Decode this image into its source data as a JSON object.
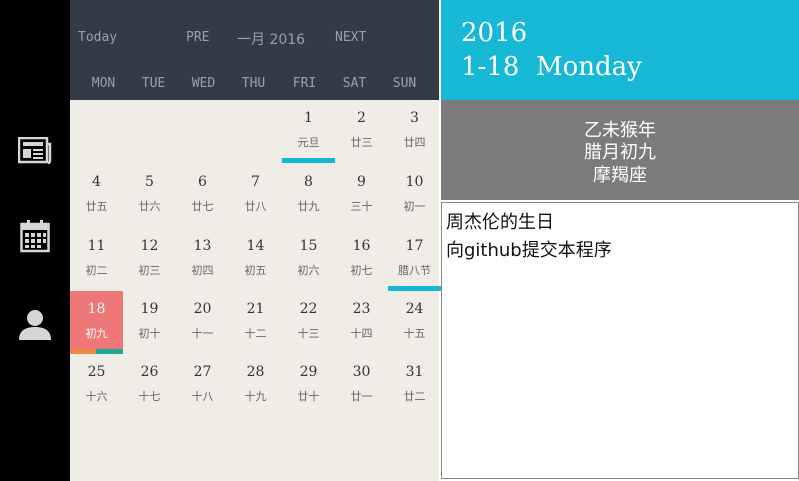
{
  "sidebar": {
    "items": [
      {
        "icon": "newspaper-icon"
      },
      {
        "icon": "calendar-icon"
      },
      {
        "icon": "user-icon"
      }
    ]
  },
  "header": {
    "today_label": "Today",
    "pre_label": "PRE",
    "month_title": "一月 2016",
    "next_label": "NEXT",
    "weekdays": [
      "MON",
      "TUE",
      "WED",
      "THU",
      "FRI",
      "SAT",
      "SUN"
    ]
  },
  "calendar": {
    "weeks": [
      [
        null,
        null,
        null,
        null,
        {
          "day": "1",
          "lunar": "元旦",
          "mark": "#17b8d6"
        },
        {
          "day": "2",
          "lunar": "廿三"
        },
        {
          "day": "3",
          "lunar": "廿四"
        }
      ],
      [
        {
          "day": "4",
          "lunar": "廿五"
        },
        {
          "day": "5",
          "lunar": "廿六"
        },
        {
          "day": "6",
          "lunar": "廿七"
        },
        {
          "day": "7",
          "lunar": "廿八"
        },
        {
          "day": "8",
          "lunar": "廿九"
        },
        {
          "day": "9",
          "lunar": "三十"
        },
        {
          "day": "10",
          "lunar": "初一"
        }
      ],
      [
        {
          "day": "11",
          "lunar": "初二"
        },
        {
          "day": "12",
          "lunar": "初三"
        },
        {
          "day": "13",
          "lunar": "初四"
        },
        {
          "day": "14",
          "lunar": "初五"
        },
        {
          "day": "15",
          "lunar": "初六"
        },
        {
          "day": "16",
          "lunar": "初七"
        },
        {
          "day": "17",
          "lunar": "腊八节",
          "mark": "#17b8d6"
        }
      ],
      [
        {
          "day": "18",
          "lunar": "初九",
          "today": true,
          "marks": [
            "#f0883e",
            "#1aa79e"
          ]
        },
        {
          "day": "19",
          "lunar": "初十"
        },
        {
          "day": "20",
          "lunar": "十一"
        },
        {
          "day": "21",
          "lunar": "十二"
        },
        {
          "day": "22",
          "lunar": "十三"
        },
        {
          "day": "23",
          "lunar": "十四"
        },
        {
          "day": "24",
          "lunar": "十五"
        }
      ],
      [
        {
          "day": "25",
          "lunar": "十六"
        },
        {
          "day": "26",
          "lunar": "十七"
        },
        {
          "day": "27",
          "lunar": "十八"
        },
        {
          "day": "28",
          "lunar": "十九"
        },
        {
          "day": "29",
          "lunar": "廿十"
        },
        {
          "day": "30",
          "lunar": "廿一"
        },
        {
          "day": "31",
          "lunar": "廿二"
        }
      ]
    ]
  },
  "selected": {
    "year": "2016",
    "date_line": "1-18  Monday",
    "ganzhi": "乙未猴年",
    "lunar_date": "腊月初九",
    "zodiac": "摩羯座"
  },
  "events": [
    "周杰伦的生日",
    "向github提交本程序"
  ],
  "colors": {
    "header_bg": "#353b46",
    "grid_bg": "#efede6",
    "accent_cyan": "#17b8d6",
    "today_bg": "#f07778",
    "lunar_panel_bg": "#7b7b7b"
  }
}
